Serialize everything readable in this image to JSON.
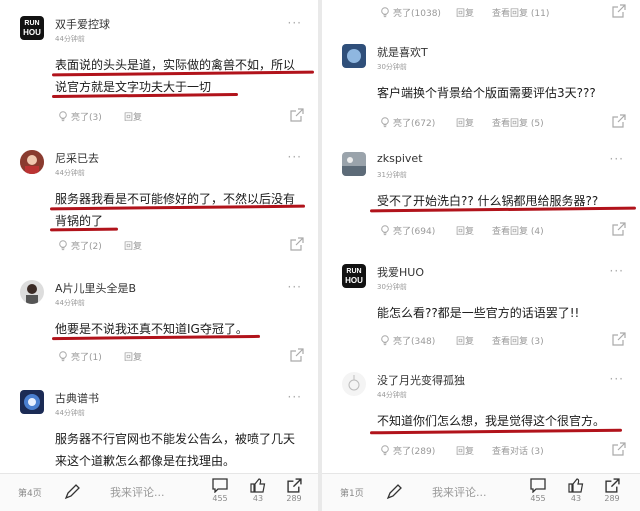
{
  "left": {
    "comments": [
      {
        "user": "双手爱控球",
        "time": "44分钟前",
        "lines": [
          "表面说的头头是道，实际做的禽兽不如，所以",
          "说官方就是文字功夫大于一切"
        ],
        "likes": "亮了(3)",
        "reply": "回复"
      },
      {
        "user": "尼采已去",
        "time": "44分钟前",
        "lines": [
          "服务器我看是不可能修好的了，不然以后没有",
          "背锅的了"
        ],
        "likes": "亮了(2)",
        "reply": "回复"
      },
      {
        "user": "A片儿里头全是B",
        "time": "44分钟前",
        "lines": [
          "他要是不说我还真不知道IG夺冠了。"
        ],
        "likes": "亮了(1)",
        "reply": "回复"
      },
      {
        "user": "古典谱书",
        "time": "44分钟前",
        "lines": [
          "服务器不行官网也不能发公告么，被喷了几天",
          "来这个道歉怎么都像是在找理由。"
        ]
      }
    ],
    "bottom": {
      "page": "第4页",
      "placeholder": "我来评论...",
      "comments": "455",
      "likes": "43",
      "shares": "289"
    }
  },
  "right": {
    "top_actions": {
      "likes": "亮了(1038)",
      "reply": "回复",
      "view": "查看回复 (11)"
    },
    "comments": [
      {
        "user": "就是喜欢T",
        "time": "30分钟前",
        "lines": [
          "客户端换个背景给个版面需要评估3天???"
        ],
        "likes": "亮了(672)",
        "reply": "回复",
        "view": "查看回复 (5)"
      },
      {
        "user": "zkspivet",
        "time": "31分钟前",
        "lines": [
          "受不了开始洗白?? 什么锅都甩给服务器??"
        ],
        "likes": "亮了(694)",
        "reply": "回复",
        "view": "查看回复 (4)"
      },
      {
        "user": "我爱HUO",
        "time": "30分钟前",
        "lines": [
          "能怎么看??都是一些官方的话语罢了!!"
        ],
        "likes": "亮了(348)",
        "reply": "回复",
        "view": "查看回复 (3)"
      },
      {
        "user": "没了月光变得孤独",
        "time": "44分钟前",
        "lines": [
          "不知道你们怎么想，我是觉得这个很官方。"
        ],
        "likes": "亮了(289)",
        "reply": "回复",
        "view": "查看对话 (3)"
      }
    ],
    "bottom": {
      "page": "第1页",
      "placeholder": "我来评论...",
      "comments": "455",
      "likes": "43",
      "shares": "289"
    }
  },
  "logo": {
    "top": "RUN",
    "mid": "HOU"
  },
  "colors": {
    "underline": "#b1131b",
    "muted": "#999999",
    "text": "#1a1a1a"
  }
}
